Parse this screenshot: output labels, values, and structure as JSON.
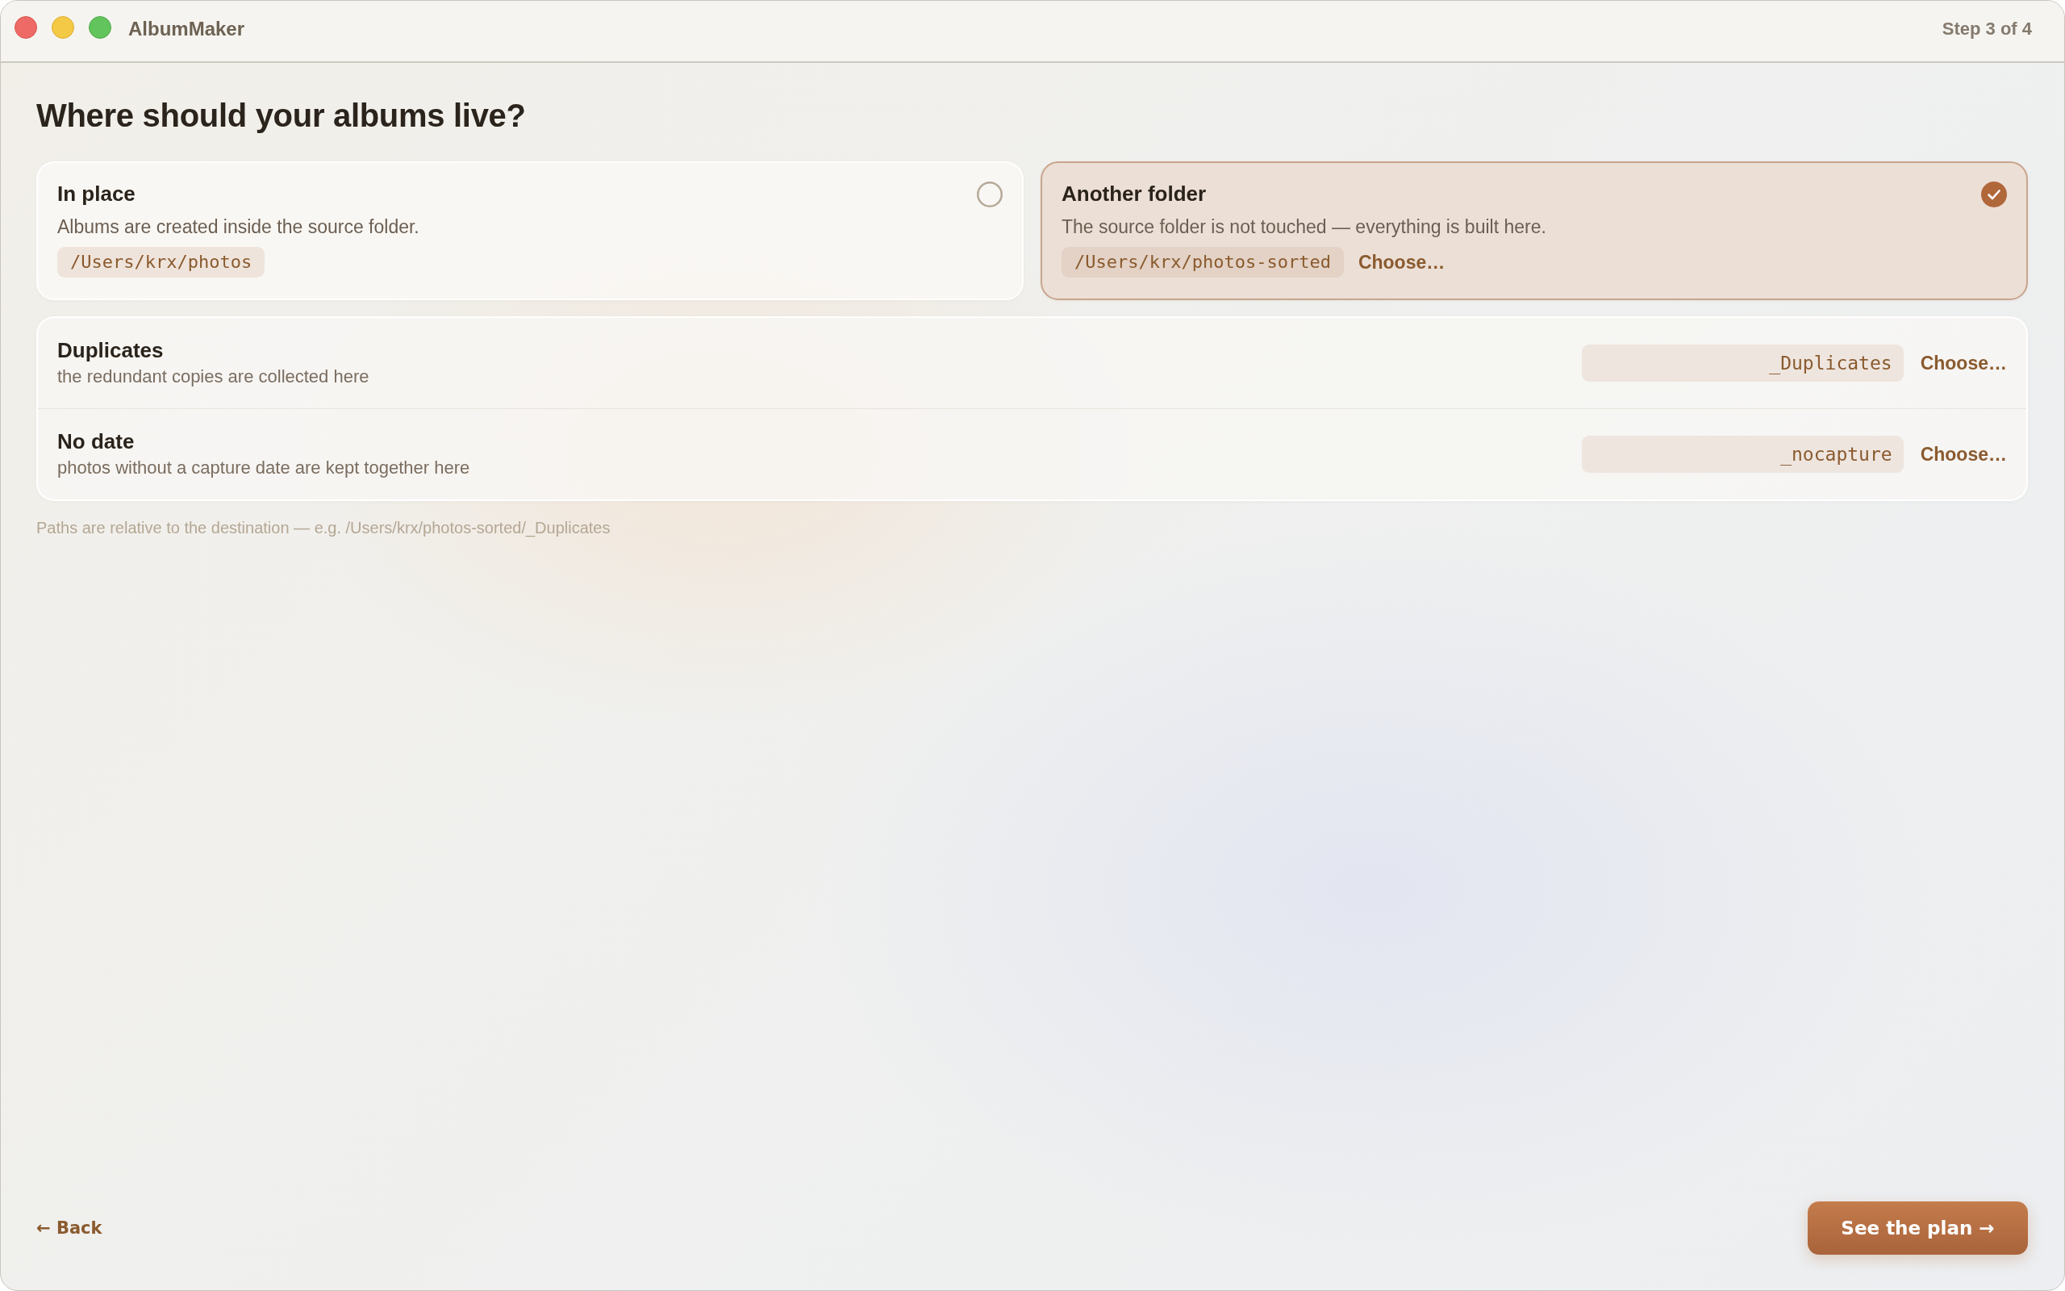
{
  "window": {
    "title": "AlbumMaker",
    "step": "Step 3 of 4"
  },
  "heading": "Where should your albums live?",
  "destination_options": [
    {
      "title": "In place",
      "description": "Albums are created inside the source folder.",
      "path": "/Users/krx/photos",
      "selected": false
    },
    {
      "title": "Another folder",
      "description": "The source folder is not touched — everything is built here.",
      "path": "/Users/krx/photos-sorted",
      "choose_label": "Choose…",
      "selected": true
    }
  ],
  "special_folders": [
    {
      "title": "Duplicates",
      "description": "the redundant copies are collected here",
      "value": "_Duplicates",
      "choose_label": "Choose…"
    },
    {
      "title": "No date",
      "description": "photos without a capture date are kept together here",
      "value": "_nocapture",
      "choose_label": "Choose…"
    }
  ],
  "note": "Paths are relative to the destination — e.g. /Users/krx/photos-sorted/_Duplicates",
  "footer": {
    "back": "← Back",
    "next": "See the plan →"
  }
}
